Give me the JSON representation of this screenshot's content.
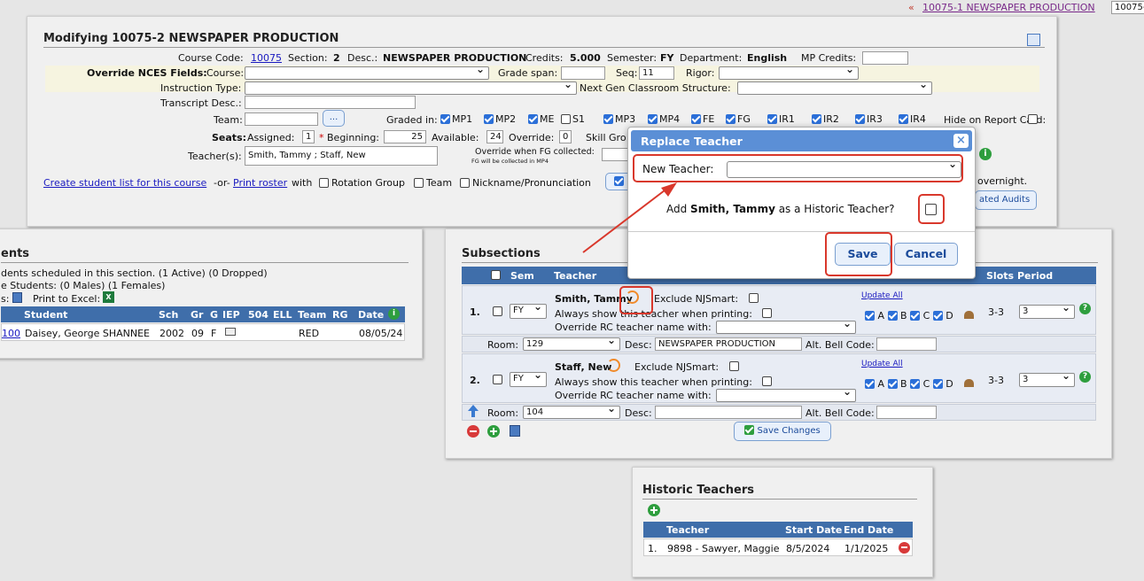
{
  "topbar": {
    "arrows": "«",
    "link": "10075-1 NEWSPAPER PRODUCTION",
    "field": "10075-"
  },
  "modify": {
    "title": "Modifying 10075-2 NEWSPAPER PRODUCTION",
    "course_code_label": "Course Code:",
    "course_code": "10075",
    "section_label": "Section:",
    "section": "2",
    "desc_label": "Desc.:",
    "desc": "NEWSPAPER PRODUCTION",
    "credits_label": "Credits:",
    "credits": "5.000",
    "semester_label": "Semester:",
    "semester": "FY",
    "department_label": "Department:",
    "department": "English",
    "mp_credits_label": "MP Credits:",
    "override_label": "Override NCES Fields:",
    "course_label": "Course:",
    "grade_span_label": "Grade span:",
    "seq_label": "Seq:",
    "seq": "11",
    "rigor_label": "Rigor:",
    "instruction_type_label": "Instruction Type:",
    "next_gen_label": "Next Gen Classroom Structure:",
    "transcript_label": "Transcript Desc.:",
    "team_label": "Team:",
    "team_btn": "...",
    "graded_in_label": "Graded in:",
    "graded": [
      {
        "label": "MP1",
        "checked": true
      },
      {
        "label": "MP2",
        "checked": true
      },
      {
        "label": "ME",
        "checked": true
      },
      {
        "label": "S1",
        "checked": false
      },
      {
        "label": "MP3",
        "checked": true
      },
      {
        "label": "MP4",
        "checked": true
      },
      {
        "label": "FE",
        "checked": true
      },
      {
        "label": "FG",
        "checked": true
      },
      {
        "label": "IR1",
        "checked": true
      },
      {
        "label": "IR2",
        "checked": true
      },
      {
        "label": "IR3",
        "checked": true
      },
      {
        "label": "IR4",
        "checked": true
      }
    ],
    "hide_label": "Hide on Report Card:",
    "seats_label": "Seats:",
    "assigned_label": "Assigned:",
    "assigned": "1",
    "beginning_label": "Beginning:",
    "beginning": "25",
    "available_label": "Available:",
    "available": "24",
    "override_seats_label": "Override:",
    "override_seats": "0",
    "skill_label": "Skill Gro",
    "teachers_label": "Teacher(s):",
    "teachers": "Smith, Tammy ; Staff, New",
    "override_fg_label": "Override when FG collected:",
    "fg_note": "FG will be collected in MP4",
    "create_link": "Create student list for this course",
    "or": "-or-",
    "print_link": "Print roster",
    "with": "with",
    "rotation": "Rotation Group",
    "team_cb": "Team",
    "nickname": "Nickname/Pronunciation",
    "overnight": "overnight.",
    "audits_btn": "ated Audits"
  },
  "students": {
    "title": "ents",
    "line1": "dents scheduled in this section. (1 Active) (0 Dropped)",
    "line2": "e Students: (0 Males) (1 Females)",
    "line3": "s:",
    "print_excel": "Print to Excel:",
    "headers": [
      "Student",
      "Sch",
      "Gr",
      "G",
      "IEP",
      "504",
      "ELL",
      "Team",
      "RG",
      "Date"
    ],
    "rows": [
      {
        "id": "100",
        "name": "Daisey, George SHANNEE",
        "sch": "2002",
        "gr": "09",
        "g": "F",
        "iep": "",
        "c504": "",
        "ell": "",
        "team": "RED",
        "rg": "",
        "date": "08/05/24"
      }
    ]
  },
  "subsections": {
    "title": "Subsections",
    "headers": {
      "sem": "Sem",
      "teacher": "Teacher",
      "slots": "Slots",
      "period": "Period"
    },
    "exclude": "Exclude NJSmart:",
    "always": "Always show this teacher when printing:",
    "override_rc": "Override RC teacher name with:",
    "update_all": "Update All",
    "days": [
      "A",
      "B",
      "C",
      "D"
    ],
    "rows": [
      {
        "num": "1.",
        "sem": "FY",
        "teacher": "Smith, Tammy",
        "slots": "3-3",
        "period": "3",
        "room": "129",
        "desc": "NEWSPAPER PRODUCTION"
      },
      {
        "num": "2.",
        "sem": "FY",
        "teacher": "Staff, New",
        "slots": "3-3",
        "period": "3",
        "room": "104",
        "desc": ""
      }
    ],
    "room_label": "Room:",
    "desc_label": "Desc:",
    "alt_bell": "Alt. Bell Code:",
    "save_changes": "Save Changes"
  },
  "dialog": {
    "title": "Replace Teacher",
    "close": "×",
    "new_teacher_label": "New Teacher:",
    "new_teacher_value": "",
    "historic_pre": "Add ",
    "historic_name": "Smith, Tammy",
    "historic_post": " as a Historic Teacher?",
    "save": "Save",
    "cancel": "Cancel"
  },
  "historic": {
    "title": "Historic Teachers",
    "headers": [
      "Teacher",
      "Start Date",
      "End Date"
    ],
    "rows": [
      {
        "num": "1.",
        "teacher": "9898 - Sawyer, Maggie",
        "start": "8/5/2024",
        "end": "1/1/2025"
      }
    ]
  },
  "colors": {
    "header_blue": "#3f6eaa",
    "dialog_title": "#5b8fd6",
    "annot_red": "#d9382c",
    "check_blue": "#2b6fd8",
    "link": "#1a1ac0"
  }
}
